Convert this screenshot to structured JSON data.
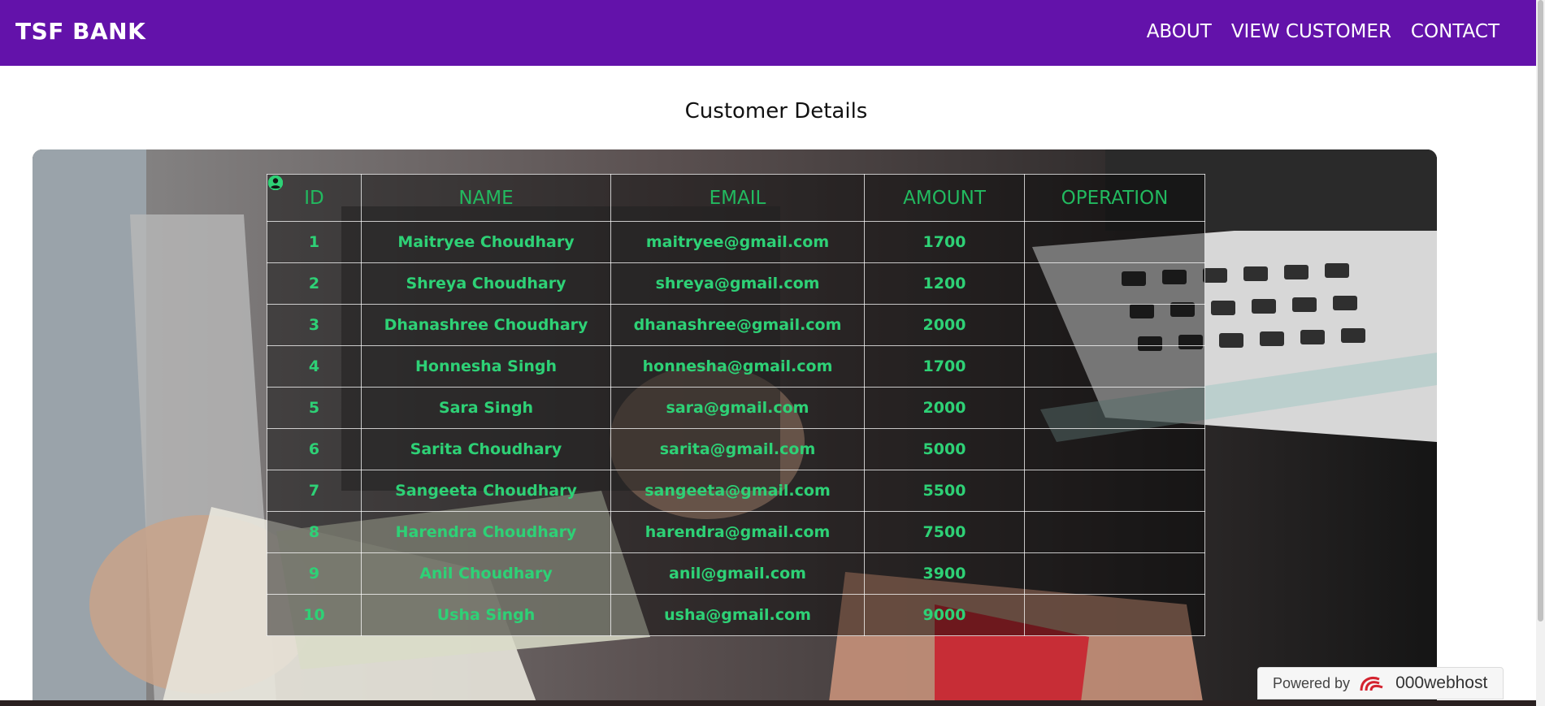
{
  "navbar": {
    "brand": "TSF BANK",
    "links": [
      {
        "label": "ABOUT"
      },
      {
        "label": "VIEW CUSTOMER"
      },
      {
        "label": "CONTACT"
      }
    ],
    "background": "#6312aa"
  },
  "page": {
    "title": "Customer Details"
  },
  "table": {
    "headers": [
      "ID",
      "NAME",
      "EMAIL",
      "AMOUNT",
      "OPERATION"
    ],
    "rows": [
      {
        "id": "1",
        "name": "Maitryee Choudhary",
        "email": "maitryee@gmail.com",
        "amount": "1700",
        "operation_icon": "user-circle-icon"
      },
      {
        "id": "2",
        "name": "Shreya Choudhary",
        "email": "shreya@gmail.com",
        "amount": "1200",
        "operation_icon": "user-circle-icon"
      },
      {
        "id": "3",
        "name": "Dhanashree Choudhary",
        "email": "dhanashree@gmail.com",
        "amount": "2000",
        "operation_icon": "user-circle-icon"
      },
      {
        "id": "4",
        "name": "Honnesha Singh",
        "email": "honnesha@gmail.com",
        "amount": "1700",
        "operation_icon": "user-circle-icon"
      },
      {
        "id": "5",
        "name": "Sara Singh",
        "email": "sara@gmail.com",
        "amount": "2000",
        "operation_icon": "user-circle-icon"
      },
      {
        "id": "6",
        "name": "Sarita Choudhary",
        "email": "sarita@gmail.com",
        "amount": "5000",
        "operation_icon": "user-circle-icon"
      },
      {
        "id": "7",
        "name": "Sangeeta Choudhary",
        "email": "sangeeta@gmail.com",
        "amount": "5500",
        "operation_icon": "user-circle-icon"
      },
      {
        "id": "8",
        "name": "Harendra Choudhary",
        "email": "harendra@gmail.com",
        "amount": "7500",
        "operation_icon": "user-circle-icon"
      },
      {
        "id": "9",
        "name": "Anil Choudhary",
        "email": "anil@gmail.com",
        "amount": "3900",
        "operation_icon": "user-circle-icon"
      },
      {
        "id": "10",
        "name": "Usha Singh",
        "email": "usha@gmail.com",
        "amount": "9000",
        "operation_icon": "user-circle-icon"
      }
    ],
    "text_color": "#2ed176"
  },
  "footer_badge": {
    "label": "Powered by",
    "brand": "000webhost"
  }
}
